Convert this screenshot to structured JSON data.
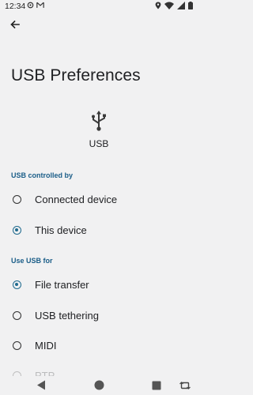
{
  "status_bar": {
    "time": "12:34",
    "left_icons": [
      "settings-gear-icon",
      "gmail-icon"
    ],
    "right_icons": [
      "location-icon",
      "wifi-icon",
      "signal-icon",
      "battery-icon"
    ]
  },
  "header": {
    "back_icon": "arrow-back-icon",
    "title": "USB Preferences"
  },
  "device": {
    "icon": "usb-icon",
    "label": "USB"
  },
  "controlled_by": {
    "header": "USB controlled by",
    "options": [
      {
        "label": "Connected device",
        "selected": false
      },
      {
        "label": "This device",
        "selected": true
      }
    ]
  },
  "use_for": {
    "header": "Use USB for",
    "options": [
      {
        "label": "File transfer",
        "selected": true
      },
      {
        "label": "USB tethering",
        "selected": false
      },
      {
        "label": "MIDI",
        "selected": false
      },
      {
        "label": "PTP",
        "selected": false
      }
    ]
  },
  "nav_bar": {
    "buttons": [
      "back-triangle-icon",
      "home-circle-icon",
      "recents-square-icon",
      "rotate-icon"
    ]
  },
  "colors": {
    "accent": "#1f6a8e",
    "section_header": "#1a5d88",
    "background": "#f1f1f2"
  }
}
